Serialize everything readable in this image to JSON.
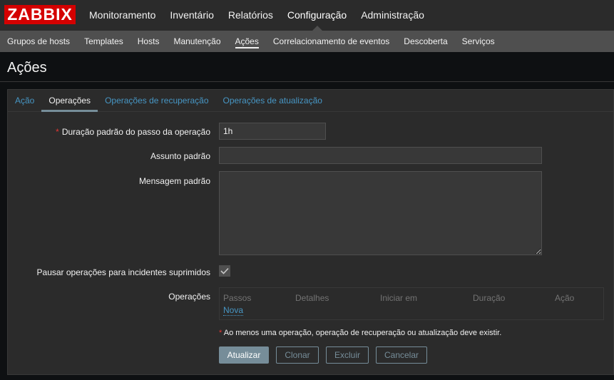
{
  "logo": {
    "text": "ZABBIX"
  },
  "topnav": {
    "items": [
      {
        "label": "Monitoramento"
      },
      {
        "label": "Inventário"
      },
      {
        "label": "Relatórios"
      },
      {
        "label": "Configuração",
        "selected": true
      },
      {
        "label": "Administração"
      }
    ]
  },
  "subnav": {
    "items": [
      {
        "label": "Grupos de hosts"
      },
      {
        "label": "Templates"
      },
      {
        "label": "Hosts"
      },
      {
        "label": "Manutenção"
      },
      {
        "label": "Ações",
        "selected": true
      },
      {
        "label": "Correlacionamento de eventos"
      },
      {
        "label": "Descoberta"
      },
      {
        "label": "Serviços"
      }
    ]
  },
  "page": {
    "title": "Ações"
  },
  "tabs": [
    {
      "label": "Ação"
    },
    {
      "label": "Operações",
      "selected": true
    },
    {
      "label": "Operações de recuperação"
    },
    {
      "label": "Operações de atualização"
    }
  ],
  "form": {
    "step_duration": {
      "required_mark": "*",
      "label": "Duração padrão do passo da operação",
      "value": "1h"
    },
    "subject": {
      "label": "Assunto padrão",
      "value": ""
    },
    "message": {
      "label": "Mensagem padrão",
      "value": ""
    },
    "pause_suppressed": {
      "label": "Pausar operações para incidentes suprimidos",
      "checked": true
    },
    "operations": {
      "label": "Operações",
      "columns": [
        "Passos",
        "Detalhes",
        "Iniciar em",
        "Duração",
        "Ação"
      ],
      "new_link": "Nova"
    },
    "note": {
      "required_mark": "*",
      "text": "Ao menos uma operação, operação de recuperação ou atualização deve existir."
    }
  },
  "buttons": {
    "update": "Atualizar",
    "clone": "Clonar",
    "delete": "Excluir",
    "cancel": "Cancelar"
  },
  "colors": {
    "brand": "#d40000",
    "link": "#4796c4",
    "button": "#768d99",
    "required": "#e33734"
  }
}
